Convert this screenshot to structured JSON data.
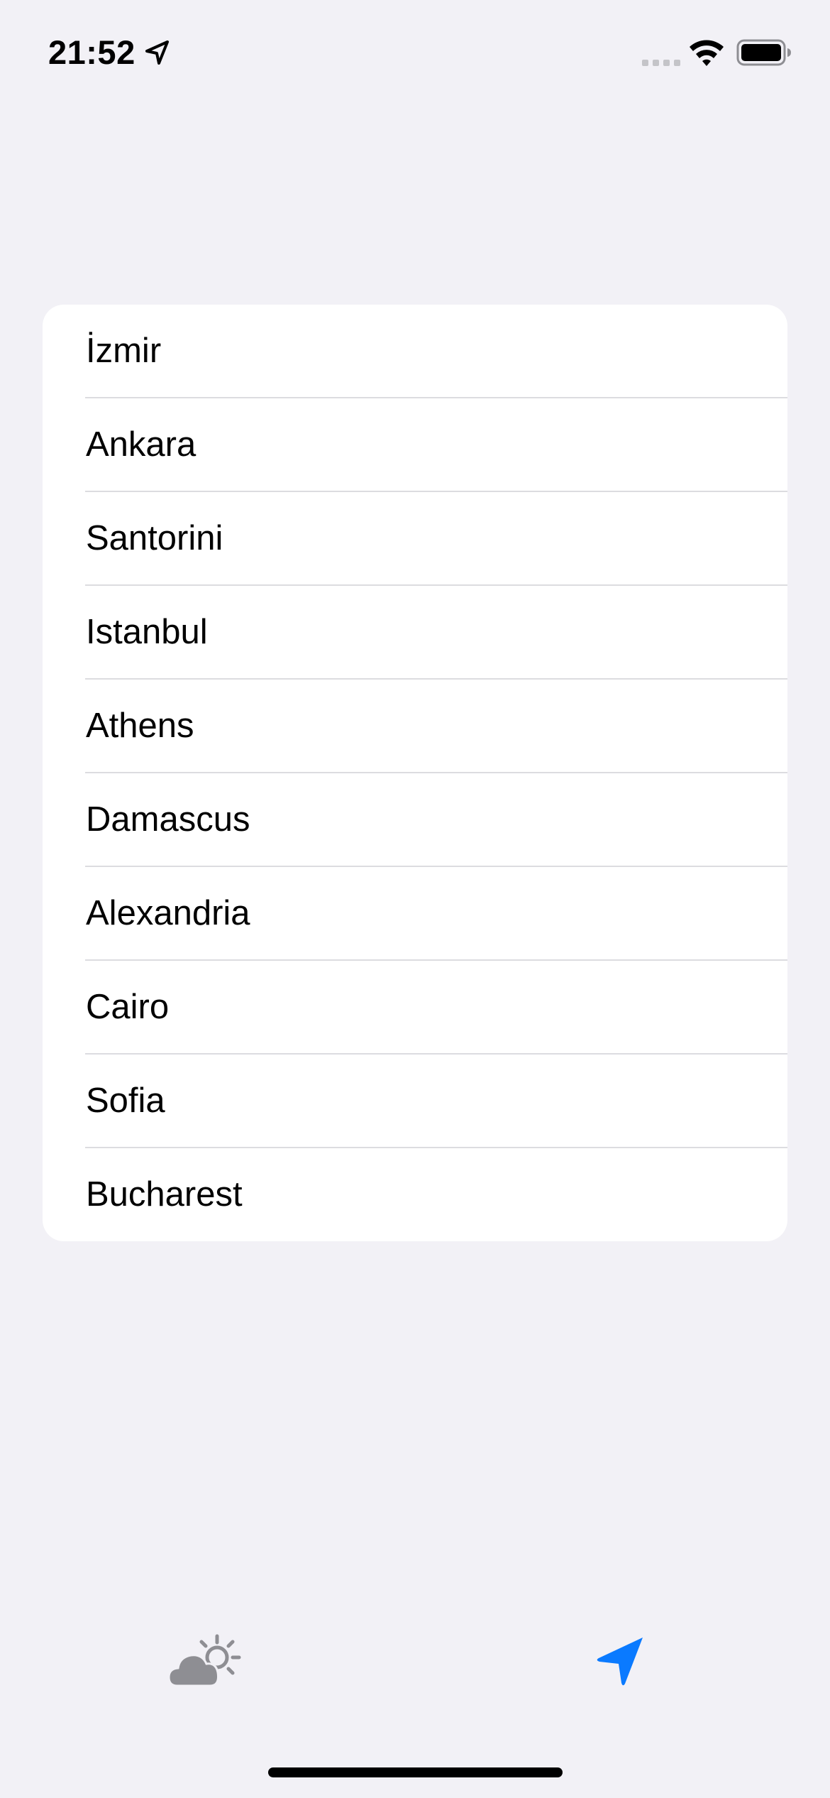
{
  "status_bar": {
    "time": "21:52",
    "icons": [
      "location-arrow-icon",
      "cell-signal-icon",
      "wifi-icon",
      "battery-icon"
    ]
  },
  "city_list": {
    "items": [
      {
        "label": "İzmir"
      },
      {
        "label": "Ankara"
      },
      {
        "label": "Santorini"
      },
      {
        "label": "Istanbul"
      },
      {
        "label": "Athens"
      },
      {
        "label": "Damascus"
      },
      {
        "label": "Alexandria"
      },
      {
        "label": "Cairo"
      },
      {
        "label": "Sofia"
      },
      {
        "label": "Bucharest"
      }
    ]
  },
  "tab_bar": {
    "tabs": [
      {
        "icon": "cloud-sun-icon",
        "selected": false
      },
      {
        "icon": "location-arrow-icon",
        "selected": true
      }
    ]
  },
  "colors": {
    "background": "#f2f1f6",
    "card": "#ffffff",
    "accent": "#0a7aff",
    "inactive_icon": "#8e8e93",
    "separator": "#dcdce0"
  }
}
